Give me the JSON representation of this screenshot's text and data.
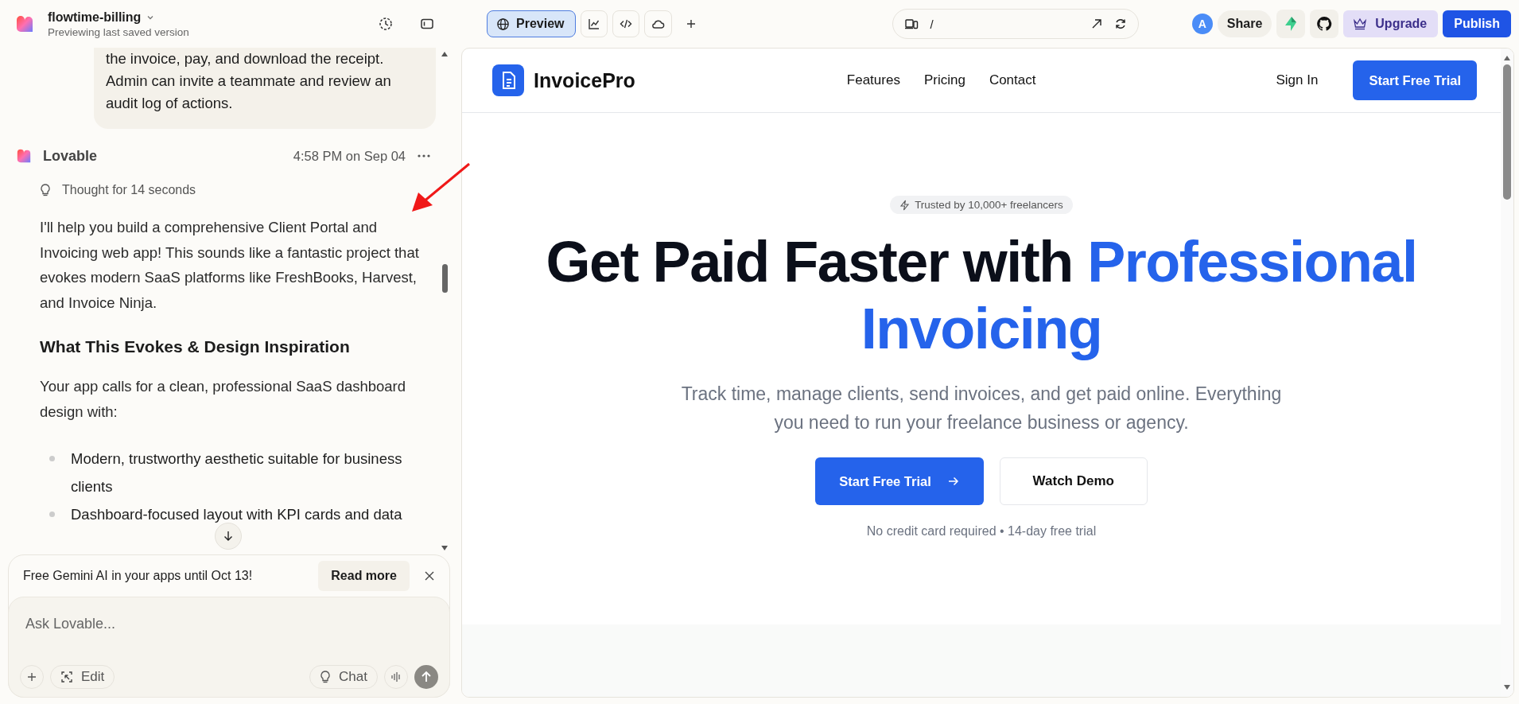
{
  "header": {
    "project_name": "flowtime-billing",
    "subtitle": "Previewing last saved version"
  },
  "view_tabs": [
    {
      "kind": "preview",
      "label": "Preview",
      "selected": true
    },
    {
      "kind": "analytics",
      "selected": false
    },
    {
      "kind": "code",
      "selected": false
    },
    {
      "kind": "cloud",
      "selected": false
    }
  ],
  "url_bar": {
    "path": "/"
  },
  "account": {
    "avatar": "A",
    "share": "Share",
    "upgrade": "Upgrade",
    "publish": "Publish"
  },
  "chat": {
    "user_message": "the invoice, pay, and download the receipt. Admin can invite a teammate and review an audit log of actions.",
    "assistant": {
      "name": "Lovable",
      "time": "4:58 PM on Sep 04",
      "thought": "Thought for 14 seconds"
    },
    "blocks": [
      {
        "kind": "paragraph",
        "text": "I'll help you build a comprehensive Client Portal and Invoicing web app! This sounds like a fantastic project that evokes modern SaaS platforms like FreshBooks, Harvest, and Invoice Ninja."
      },
      {
        "kind": "heading",
        "text": "What This Evokes & Design Inspiration"
      },
      {
        "kind": "paragraph",
        "text": "Your app calls for a clean, professional SaaS dashboard design with:"
      },
      {
        "kind": "bullets",
        "items": [
          "Modern, trustworthy aesthetic suitable for business clients",
          "Dashboard-focused layout with KPI cards and data"
        ]
      }
    ]
  },
  "banner": {
    "text": "Free Gemini AI in your apps until Oct 13!",
    "action": "Read more"
  },
  "composer": {
    "placeholder": "Ask Lovable...",
    "edit": "Edit",
    "chat": "Chat"
  },
  "site": {
    "brand": "InvoicePro",
    "nav": [
      "Features",
      "Pricing",
      "Contact"
    ],
    "sign_in": "Sign In",
    "cta": "Start Free Trial",
    "badge": "Trusted by 10,000+ freelancers",
    "title": "Get Paid Faster with",
    "title_highlight": "Professional Invoicing",
    "subtitle": "Track time, manage clients, send invoices, and get paid online. Everything you need to run your freelance business or agency.",
    "primary": "Start Free Trial",
    "secondary": "Watch Demo",
    "note": "No credit card required • 14-day free trial"
  }
}
